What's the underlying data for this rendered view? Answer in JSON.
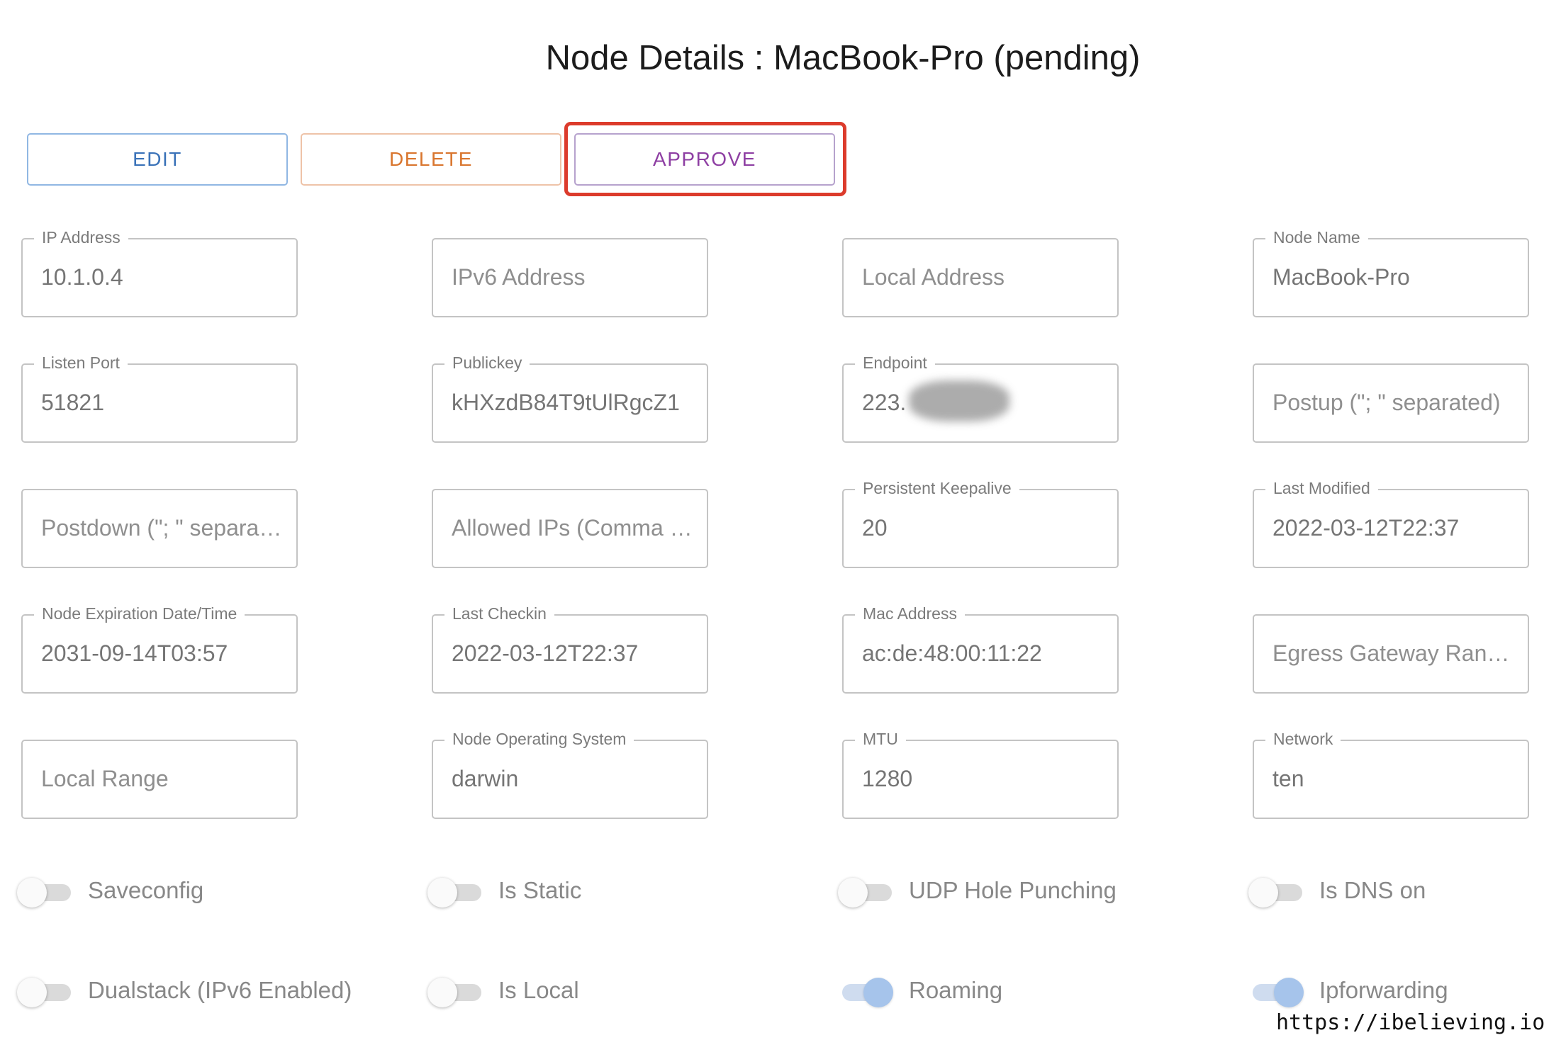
{
  "page": {
    "title": "Node Details : MacBook-Pro (pending)"
  },
  "actions": {
    "edit": "EDIT",
    "delete": "DELETE",
    "approve": "APPROVE"
  },
  "fields": [
    {
      "label": "IP Address",
      "value": "10.1.0.4"
    },
    {
      "label": "",
      "value": "IPv6 Address"
    },
    {
      "label": "",
      "value": "Local Address"
    },
    {
      "label": "Node Name",
      "value": "MacBook-Pro"
    },
    {
      "label": "Listen Port",
      "value": "51821"
    },
    {
      "label": "Publickey",
      "value": "kHXzdB84T9tUlRgcZ1"
    },
    {
      "label": "Endpoint",
      "value": "223."
    },
    {
      "label": "",
      "value": "Postup (\"; \" separated)"
    },
    {
      "label": "",
      "value": "Postdown (\"; \" separated)"
    },
    {
      "label": "",
      "value": "Allowed IPs (Comma separated)"
    },
    {
      "label": "Persistent Keepalive",
      "value": "20"
    },
    {
      "label": "Last Modified",
      "value": "2022-03-12T22:37"
    },
    {
      "label": "Node Expiration Date/Time",
      "value": "2031-09-14T03:57"
    },
    {
      "label": "Last Checkin",
      "value": "2022-03-12T22:37"
    },
    {
      "label": "Mac Address",
      "value": "ac:de:48:00:11:22"
    },
    {
      "label": "",
      "value": "Egress Gateway Ranges"
    },
    {
      "label": "",
      "value": "Local Range"
    },
    {
      "label": "Node Operating System",
      "value": "darwin"
    },
    {
      "label": "MTU",
      "value": "1280"
    },
    {
      "label": "Network",
      "value": "ten"
    }
  ],
  "toggles": [
    {
      "label": "Saveconfig",
      "on": false
    },
    {
      "label": "Is Static",
      "on": false
    },
    {
      "label": "UDP Hole Punching",
      "on": false
    },
    {
      "label": "Is DNS on",
      "on": false
    },
    {
      "label": "Dualstack (IPv6 Enabled)",
      "on": false
    },
    {
      "label": "Is Local",
      "on": false
    },
    {
      "label": "Roaming",
      "on": true
    },
    {
      "label": "Ipforwarding",
      "on": true
    }
  ],
  "watermark": "https://ibelieving.io"
}
